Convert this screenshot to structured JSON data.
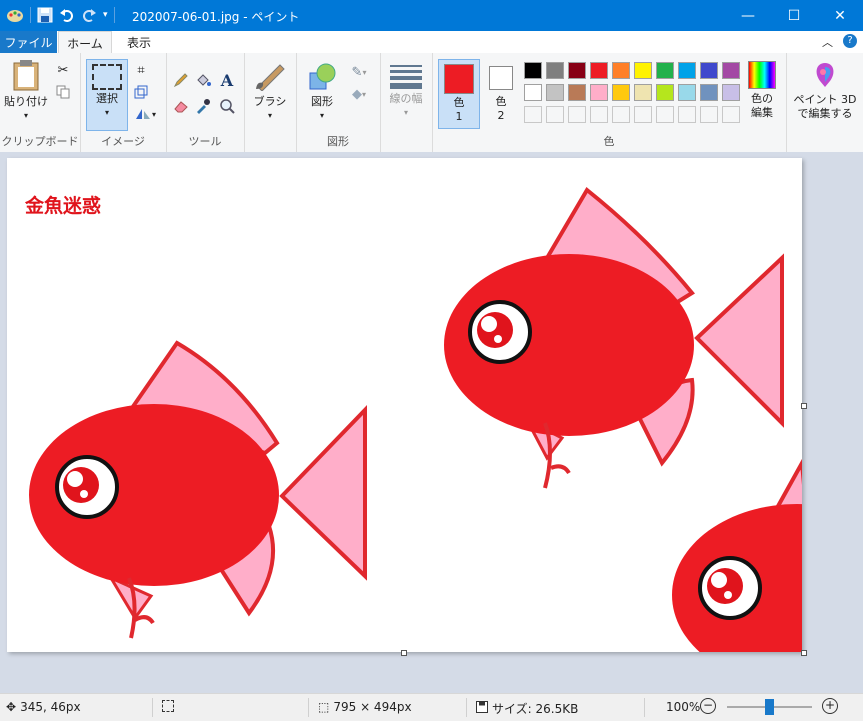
{
  "title": "202007-06-01.jpg - ペイント",
  "tabs": {
    "file": "ファイル",
    "home": "ホーム",
    "view": "表示"
  },
  "ribbon": {
    "clipboard": {
      "paste": "貼り付け",
      "label": "クリップボード"
    },
    "image": {
      "select": "選択",
      "label": "イメージ"
    },
    "tools": {
      "label": "ツール"
    },
    "brushes": {
      "label": "ブラシ"
    },
    "shapes": {
      "button": "図形",
      "label": "図形"
    },
    "size": {
      "label": "線の幅"
    },
    "colors": {
      "color1": "色",
      "color1_num": "1",
      "color2": "色",
      "color2_num": "2",
      "edit_line1": "色の",
      "edit_line2": "編集",
      "label": "色",
      "color1_value": "#ed1c24",
      "color2_value": "#ffffff",
      "palette_row1": [
        "#000000",
        "#7f7f7f",
        "#880015",
        "#ed1c24",
        "#ff7f27",
        "#fff200",
        "#22b14c",
        "#00a2e8",
        "#3f48cc",
        "#a349a4"
      ],
      "palette_row2": [
        "#ffffff",
        "#c3c3c3",
        "#b97a57",
        "#ffaec9",
        "#ffc90e",
        "#efe4b0",
        "#b5e61d",
        "#99d9ea",
        "#7092be",
        "#c8bfe7"
      ]
    },
    "paint3d": {
      "line1": "ペイント 3D",
      "line2": "で編集する"
    }
  },
  "canvas": {
    "text": "金魚迷惑"
  },
  "status": {
    "cursor": "345, 46px",
    "image_size": "795 × 494px",
    "file_size": "サイズ: 26.5KB",
    "zoom": "100%",
    "zoom_level": 0.5
  }
}
